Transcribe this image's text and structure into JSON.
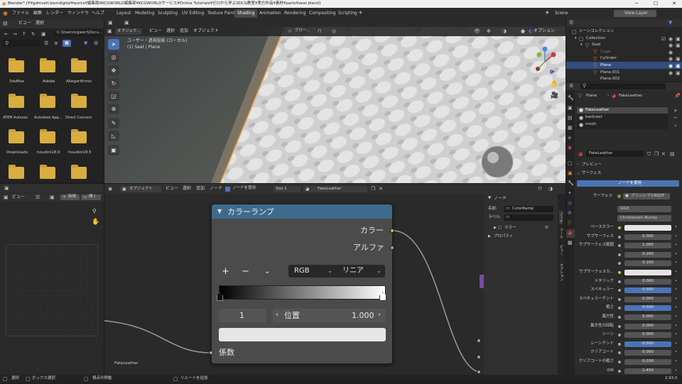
{
  "window": {
    "title": "Blender* [¥¥gdmvelt.bomdigital¥works¥編集局¥KCGWORLD編集部¥KCGWORLDサービス¥Online Tutorials¥ゼロから学ぶ3DCG教室¥実方作品¥素材¥parts¥seat.blend]"
  },
  "menu": {
    "items": [
      "ファイル",
      "編集",
      "レンダー",
      "ウィンドウ",
      "ヘルプ"
    ]
  },
  "workspaces": [
    "Layout",
    "Modeling",
    "Sculpting",
    "UV Editing",
    "Texture Paint",
    "Shading",
    "Animation",
    "Rendering",
    "Compositing",
    "Scripting"
  ],
  "active_workspace": "Shading",
  "top_right": {
    "scene": "Scene",
    "view_layer": "View Layer"
  },
  "file_browser": {
    "menu": [
      "ビュー",
      "選択"
    ],
    "path": "C:\\Users\\cgworl\\Docu...",
    "folders": [
      "3dsMax",
      "Adobe",
      "Allegorithmic",
      "ATEM Autosav",
      "Autodesk App...",
      "Direct Connect",
      "Downloads",
      "houdini18.0",
      "houdini18.5",
      "",
      "",
      ""
    ]
  },
  "image_editor": {
    "view": "ビュー",
    "new": "新規",
    "open": "開く"
  },
  "viewport": {
    "mode": "オブジェク...",
    "menus": [
      "ビュー",
      "選択",
      "追加",
      "オブジェクト"
    ],
    "transform": "グロー...",
    "options": "オプション",
    "info_line1": "ユーザー・透視投影 (ローカル)",
    "info_line2": "(1) Seat | Plane"
  },
  "node_editor": {
    "mode": "オブジェクト",
    "menus": [
      "ビュー",
      "選択",
      "追加",
      "ノード"
    ],
    "use_nodes_label": "ノードを使用",
    "slot": "Slot 1",
    "material": "FakeLeather",
    "material_label": "FakeLeather"
  },
  "color_ramp": {
    "title": "カラーランプ",
    "out_color": "カラー",
    "out_alpha": "アルファ",
    "mode": "RGB",
    "interp": "リニア",
    "stop_index": "1",
    "pos_label": "位置",
    "pos_value": "1.000",
    "fac_label": "係数",
    "plus": "+",
    "minus": "−"
  },
  "n_panel": {
    "section_node": "ノード",
    "name_label": "名前:",
    "name_value": "ColorRamp",
    "label_label": "ラベル:",
    "color": "カラー",
    "properties": "プロパティ",
    "tabs": [
      "ノード",
      "ツール",
      "ビュー",
      "オプション"
    ]
  },
  "outliner": {
    "root": "シーンコレクション",
    "items": [
      "Collection",
      "Seat",
      "Cage",
      "Cylinder",
      "Plane",
      "Plane.001",
      "Plane.002"
    ]
  },
  "properties": {
    "object": "Plane",
    "material": "FakeLeather",
    "slots": [
      "FakeLeather",
      "backrest",
      "mesh"
    ],
    "material_field": "FakeLeather",
    "preview": "プレビュー",
    "surface_section": "サーフェス",
    "use_nodes": "ノードを使用",
    "surface_label": "サーフェス",
    "surface_value": "プリンシプルBSDF",
    "distribution": "GGX",
    "subsurface_method": "Christensen-Burley",
    "rows": [
      {
        "label": "ベースカラー",
        "value": "",
        "kind": "white"
      },
      {
        "label": "サブサーフェス",
        "value": "0.000",
        "kind": "grey"
      },
      {
        "label": "サブサーフェス範囲",
        "value": "1.000",
        "kind": "grey"
      },
      {
        "label": "",
        "value": "0.200",
        "kind": "grey"
      },
      {
        "label": "",
        "value": "0.100",
        "kind": "grey"
      },
      {
        "label": "サブサーフェスカ...",
        "value": "",
        "kind": "white"
      },
      {
        "label": "メタリック",
        "value": "0.000",
        "kind": "grey"
      },
      {
        "label": "スペキュラー",
        "value": "0.500",
        "kind": "blue"
      },
      {
        "label": "スペキュラーチント",
        "value": "0.000",
        "kind": "grey"
      },
      {
        "label": "粗さ",
        "value": "0.500",
        "kind": "blue"
      },
      {
        "label": "異方性",
        "value": "0.000",
        "kind": "grey"
      },
      {
        "label": "異方性の回転",
        "value": "0.000",
        "kind": "grey"
      },
      {
        "label": "シーン",
        "value": "0.000",
        "kind": "grey"
      },
      {
        "label": "シーンチント",
        "value": "0.500",
        "kind": "blue"
      },
      {
        "label": "クリアコート",
        "value": "0.000",
        "kind": "grey"
      },
      {
        "label": "クリアコートの粗さ",
        "value": "0.030",
        "kind": "grey"
      },
      {
        "label": "IOR",
        "value": "1.450",
        "kind": "grey"
      },
      {
        "label": "伝播",
        "value": "0.000",
        "kind": "grey"
      }
    ]
  },
  "status": {
    "left": "選択",
    "box": "ボックス選択",
    "rotate": "視点の移動",
    "link": "リルートを追加",
    "version": "2.93.0"
  },
  "colors": {
    "accent": "#4b74b6",
    "node_header": "#3e6b8c",
    "socket_yellow": "#c7c729",
    "folder": "#d9ad40",
    "active_tab": "#4a4a4a"
  }
}
